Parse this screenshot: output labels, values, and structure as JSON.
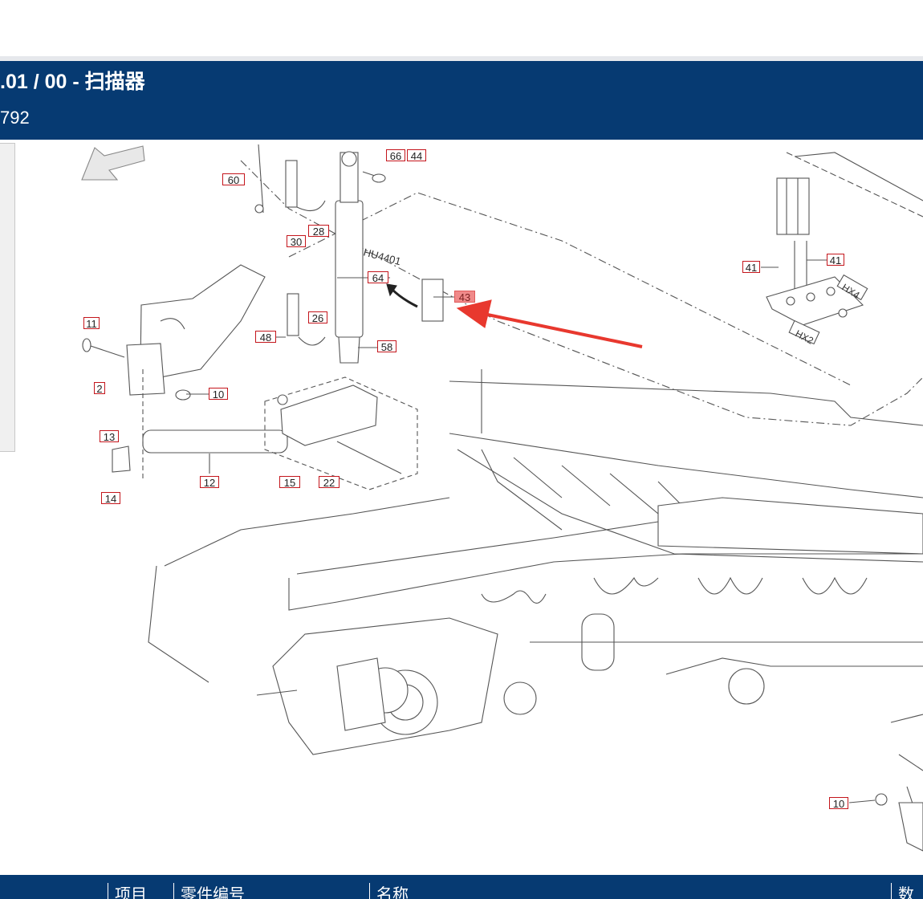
{
  "header": {
    "title": ".01 / 00 - 扫描器",
    "subtitle": "792"
  },
  "diagram": {
    "callouts": [
      {
        "label": "60",
        "highlighted": false
      },
      {
        "label": "66",
        "highlighted": false
      },
      {
        "label": "44",
        "highlighted": false
      },
      {
        "label": "30",
        "highlighted": false
      },
      {
        "label": "28",
        "highlighted": false
      },
      {
        "label": "64",
        "highlighted": false
      },
      {
        "label": "43",
        "highlighted": true
      },
      {
        "label": "41",
        "highlighted": false
      },
      {
        "label": "41",
        "highlighted": false
      },
      {
        "label": "11",
        "highlighted": false
      },
      {
        "label": "48",
        "highlighted": false
      },
      {
        "label": "26",
        "highlighted": false
      },
      {
        "label": "58",
        "highlighted": false
      },
      {
        "label": "2",
        "highlighted": false
      },
      {
        "label": "10",
        "highlighted": false
      },
      {
        "label": "13",
        "highlighted": false
      },
      {
        "label": "12",
        "highlighted": false
      },
      {
        "label": "15",
        "highlighted": false
      },
      {
        "label": "22",
        "highlighted": false
      },
      {
        "label": "14",
        "highlighted": false
      },
      {
        "label": "10",
        "highlighted": false
      }
    ],
    "part_text": {
      "part_id": "HU4401",
      "hx4": "HX4",
      "hx2": "HX2"
    },
    "arrow_color": "#e8382e",
    "callout_border_color": "#c4161c"
  },
  "table": {
    "columns": [
      "项目",
      "零件编号",
      "名称",
      "数"
    ]
  },
  "colors": {
    "header_bg": "#063a72",
    "line_art": "#555555"
  }
}
